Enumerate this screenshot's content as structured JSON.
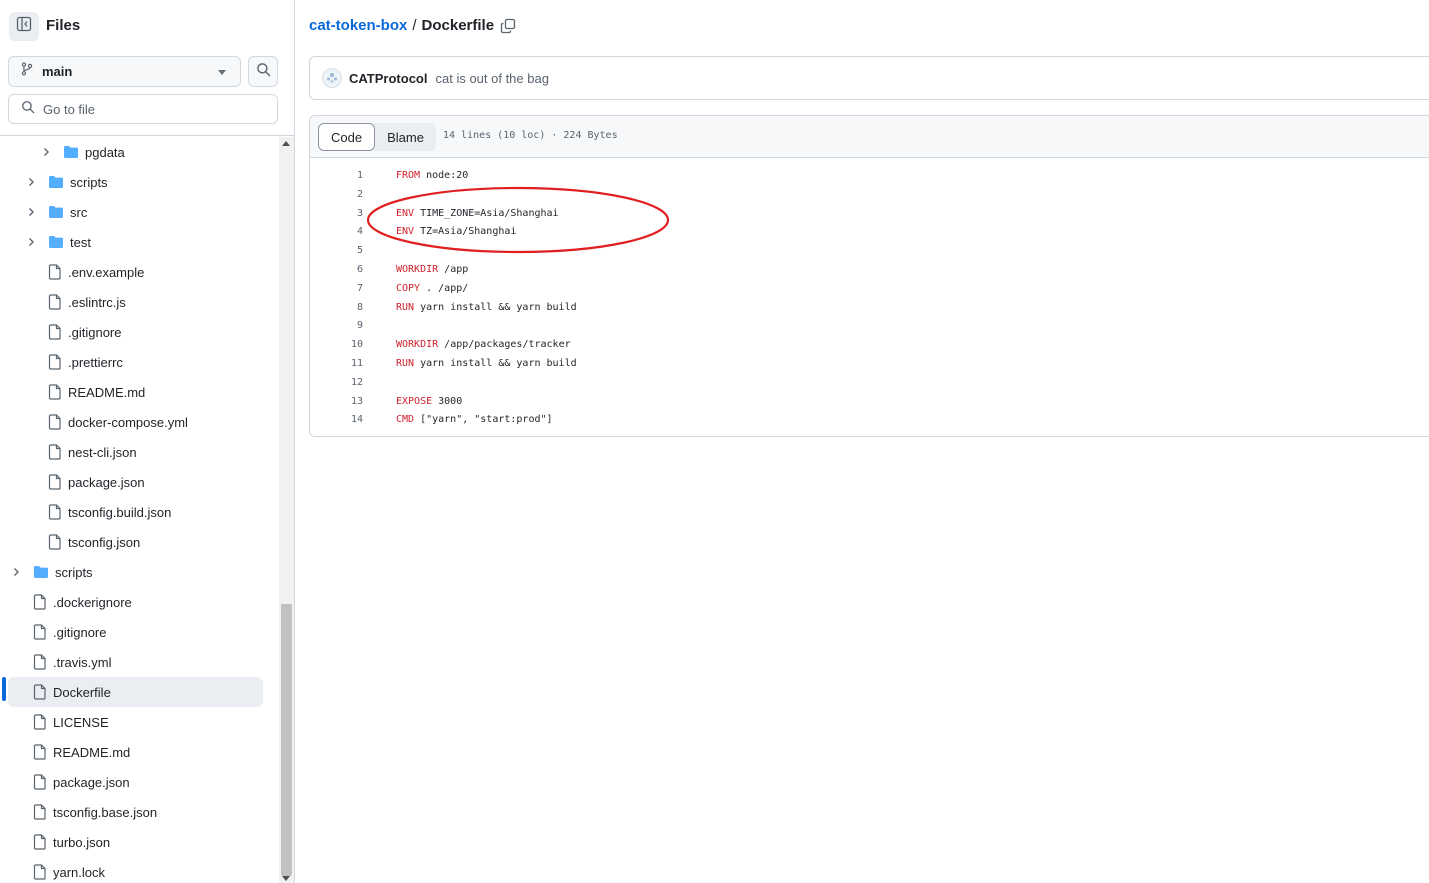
{
  "sidebar": {
    "title": "Files",
    "branch": "main",
    "goto_placeholder": "Go to file",
    "items": [
      {
        "name": "pgdata",
        "type": "folder",
        "depth": 2
      },
      {
        "name": "scripts",
        "type": "folder",
        "depth": 1
      },
      {
        "name": "src",
        "type": "folder",
        "depth": 1
      },
      {
        "name": "test",
        "type": "folder",
        "depth": 1
      },
      {
        "name": ".env.example",
        "type": "file",
        "depth": 1
      },
      {
        "name": ".eslintrc.js",
        "type": "file",
        "depth": 1
      },
      {
        "name": ".gitignore",
        "type": "file",
        "depth": 1
      },
      {
        "name": ".prettierrc",
        "type": "file",
        "depth": 1
      },
      {
        "name": "README.md",
        "type": "file",
        "depth": 1
      },
      {
        "name": "docker-compose.yml",
        "type": "file",
        "depth": 1
      },
      {
        "name": "nest-cli.json",
        "type": "file",
        "depth": 1
      },
      {
        "name": "package.json",
        "type": "file",
        "depth": 1
      },
      {
        "name": "tsconfig.build.json",
        "type": "file",
        "depth": 1
      },
      {
        "name": "tsconfig.json",
        "type": "file",
        "depth": 1
      },
      {
        "name": "scripts",
        "type": "folder",
        "depth": 0
      },
      {
        "name": ".dockerignore",
        "type": "file",
        "depth": 0
      },
      {
        "name": ".gitignore",
        "type": "file",
        "depth": 0
      },
      {
        "name": ".travis.yml",
        "type": "file",
        "depth": 0
      },
      {
        "name": "Dockerfile",
        "type": "file",
        "depth": 0,
        "selected": true
      },
      {
        "name": "LICENSE",
        "type": "file",
        "depth": 0
      },
      {
        "name": "README.md",
        "type": "file",
        "depth": 0
      },
      {
        "name": "package.json",
        "type": "file",
        "depth": 0
      },
      {
        "name": "tsconfig.base.json",
        "type": "file",
        "depth": 0
      },
      {
        "name": "turbo.json",
        "type": "file",
        "depth": 0
      },
      {
        "name": "yarn.lock",
        "type": "file",
        "depth": 0
      }
    ]
  },
  "breadcrumb": {
    "repo": "cat-token-box",
    "separator": "/",
    "file": "Dockerfile"
  },
  "commit": {
    "author": "CATProtocol",
    "message": "cat is out of the bag"
  },
  "code_view": {
    "tabs": [
      "Code",
      "Blame"
    ],
    "active_tab": "Code",
    "file_info": "14 lines (10 loc) · 224 Bytes",
    "lines": [
      {
        "n": "1",
        "kw": "FROM",
        "rest": " node:20"
      },
      {
        "n": "2",
        "kw": "",
        "rest": ""
      },
      {
        "n": "3",
        "kw": "ENV",
        "rest": " TIME_ZONE=Asia/Shanghai"
      },
      {
        "n": "4",
        "kw": "ENV",
        "rest": " TZ=Asia/Shanghai"
      },
      {
        "n": "5",
        "kw": "",
        "rest": ""
      },
      {
        "n": "6",
        "kw": "WORKDIR",
        "rest": " /app"
      },
      {
        "n": "7",
        "kw": "COPY",
        "rest": " . /app/"
      },
      {
        "n": "8",
        "kw": "RUN",
        "rest": " yarn install && yarn build"
      },
      {
        "n": "9",
        "kw": "",
        "rest": ""
      },
      {
        "n": "10",
        "kw": "WORKDIR",
        "rest": " /app/packages/tracker"
      },
      {
        "n": "11",
        "kw": "RUN",
        "rest": " yarn install && yarn build"
      },
      {
        "n": "12",
        "kw": "",
        "rest": ""
      },
      {
        "n": "13",
        "kw": "EXPOSE",
        "rest": " 3000"
      },
      {
        "n": "14",
        "kw": "CMD",
        "rest": " [\"yarn\", \"start:prod\"]"
      }
    ]
  },
  "colors": {
    "accent": "#0969da",
    "folder": "#54aeff",
    "keyword": "#cf222e",
    "annotation": "#e02020"
  }
}
